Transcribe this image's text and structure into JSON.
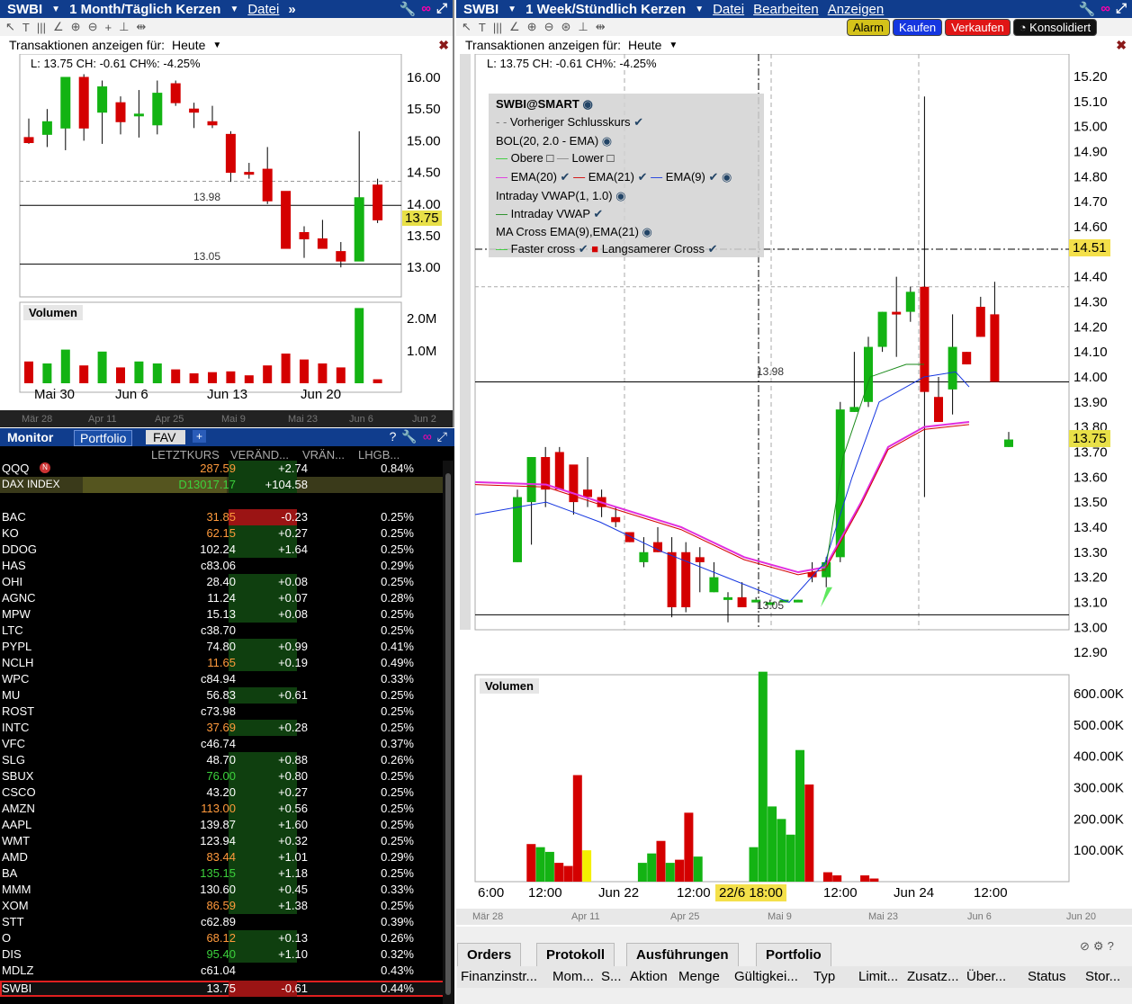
{
  "left_chart": {
    "symbol": "SWBI",
    "period": "1 Month/Täglich Kerzen",
    "menu_datei": "Datei",
    "tx_label": "Transaktionen anzeigen für:",
    "tx_value": "Heute",
    "info": "L: 13.75 CH: -0.61 CH%: -4.25%",
    "price_ticks": [
      "16.00",
      "15.50",
      "15.00",
      "14.50",
      "14.00",
      "13.50",
      "13.00"
    ],
    "line_labels": [
      "13.98",
      "13.05"
    ],
    "last_price": "13.75",
    "volume_title": "Volumen",
    "volume_ticks": [
      "2.0M",
      "1.0M"
    ],
    "date_ticks": [
      "Mai 30",
      "Jun 6",
      "Jun 13",
      "Jun 20"
    ],
    "scroll_ticks": [
      "Mär 28",
      "Apr 11",
      "Apr 25",
      "Mai 9",
      "Mai 23",
      "Jun 6",
      "Jun 2"
    ]
  },
  "chart_data": {
    "type": "candlestick",
    "series": [
      {
        "name": "SWBI",
        "candles": [
          {
            "o": 15.05,
            "h": 15.35,
            "l": 14.95,
            "c": 14.97
          },
          {
            "o": 15.1,
            "h": 15.5,
            "l": 14.9,
            "c": 15.3
          },
          {
            "o": 15.2,
            "h": 16.0,
            "l": 14.85,
            "c": 16.0
          },
          {
            "o": 16.0,
            "h": 16.05,
            "l": 15.0,
            "c": 15.2
          },
          {
            "o": 15.45,
            "h": 15.95,
            "l": 14.95,
            "c": 15.85
          },
          {
            "o": 15.6,
            "h": 15.7,
            "l": 15.1,
            "c": 15.3
          },
          {
            "o": 15.4,
            "h": 15.8,
            "l": 15.05,
            "c": 15.42
          },
          {
            "o": 15.25,
            "h": 15.95,
            "l": 15.1,
            "c": 15.75
          },
          {
            "o": 15.9,
            "h": 15.95,
            "l": 15.55,
            "c": 15.6
          },
          {
            "o": 15.5,
            "h": 15.6,
            "l": 15.2,
            "c": 15.45
          },
          {
            "o": 15.3,
            "h": 15.55,
            "l": 15.2,
            "c": 15.25
          },
          {
            "o": 15.1,
            "h": 15.15,
            "l": 14.35,
            "c": 14.5
          },
          {
            "o": 14.5,
            "h": 14.65,
            "l": 14.4,
            "c": 14.47
          },
          {
            "o": 14.55,
            "h": 14.9,
            "l": 14.0,
            "c": 14.05
          },
          {
            "o": 14.2,
            "h": 14.2,
            "l": 13.3,
            "c": 13.3
          },
          {
            "o": 13.55,
            "h": 13.65,
            "l": 13.15,
            "c": 13.45
          },
          {
            "o": 13.45,
            "h": 13.75,
            "l": 13.3,
            "c": 13.3
          },
          {
            "o": 13.25,
            "h": 13.4,
            "l": 13.0,
            "c": 13.1
          },
          {
            "o": 13.1,
            "h": 15.15,
            "l": 13.1,
            "c": 14.1
          },
          {
            "o": 14.3,
            "h": 14.4,
            "l": 13.7,
            "c": 13.75
          }
        ]
      }
    ],
    "volume": [
      0.55,
      0.5,
      0.85,
      0.45,
      0.8,
      0.4,
      0.55,
      0.5,
      0.35,
      0.25,
      0.28,
      0.3,
      0.2,
      0.45,
      0.75,
      0.6,
      0.5,
      0.4,
      1.9,
      0.1
    ]
  },
  "right_chart": {
    "symbol": "SWBI",
    "period": "1 Week/Stündlich Kerzen",
    "menus": [
      "Datei",
      "Bearbeiten",
      "Anzeigen"
    ],
    "buttons": {
      "alarm": "Alarm",
      "buy": "Kaufen",
      "sell": "Verkaufen",
      "consolidated": "Konsolidiert"
    },
    "tx_label": "Transaktionen anzeigen für:",
    "tx_value": "Heute",
    "info": "L: 13.75 CH: -0.61 CH%: -4.25%",
    "legend": {
      "title": "SWBI@SMART",
      "prev_close": "Vorheriger Schlusskurs",
      "bol": "BOL(20, 2.0 - EMA)",
      "upper": "Obere",
      "lower": "Lower",
      "ema20": "EMA(20)",
      "ema21": "EMA(21)",
      "ema9": "EMA(9)",
      "vwap": "Intraday VWAP(1, 1.0)",
      "vwap_line": "Intraday VWAP",
      "macross": "MA Cross EMA(9),EMA(21)",
      "faster": "Faster cross",
      "slower": "Langsamerer Cross"
    },
    "price_ticks": [
      "15.20",
      "15.10",
      "15.00",
      "14.90",
      "14.80",
      "14.70",
      "14.60",
      "14.50",
      "14.40",
      "14.30",
      "14.20",
      "14.10",
      "14.00",
      "13.90",
      "13.80",
      "13.70",
      "13.60",
      "13.50",
      "13.40",
      "13.30",
      "13.20",
      "13.10",
      "13.00",
      "12.90"
    ],
    "crosshair_price": "14.51",
    "last_price": "13.75",
    "line_labels": [
      "13.98",
      "13.05"
    ],
    "volume_title": "Volumen",
    "volume_ticks": [
      "600.00K",
      "500.00K",
      "400.00K",
      "300.00K",
      "200.00K",
      "100.00K"
    ],
    "time_ticks": [
      "6:00",
      "12:00",
      "Jun 22",
      "12:00",
      "12:00",
      "Jun 24",
      "12:00"
    ],
    "crosshair_time": "22/6 18:00",
    "scroll_ticks": [
      "Mär 28",
      "Apr 11",
      "Apr 25",
      "Mai 9",
      "Mai 23",
      "Jun 6",
      "Jun 20"
    ]
  },
  "monitor": {
    "tabs": [
      "Monitor",
      "Portfolio",
      "FAV",
      "+"
    ],
    "columns": [
      "LETZTKURS",
      "VERÄND...",
      "VRÄN...",
      "LHGB..."
    ],
    "rows": [
      {
        "sym": "QQQ",
        "last": "287.59",
        "chg": "+2.74",
        "pct": "0.84%",
        "lc": "#ff9a3c",
        "cc": "#fff"
      },
      {
        "sym": "DAX INDEX",
        "last": "D13017.17",
        "chg": "+104.58",
        "pct": "",
        "lc": "#3cd23c",
        "cc": "#fff"
      },
      {
        "sym": "",
        "last": "",
        "chg": "",
        "pct": "",
        "lc": "#fff",
        "cc": "#fff"
      },
      {
        "sym": "BAC",
        "last": "31.85",
        "chg": "-0.23",
        "pct": "0.25%",
        "lc": "#ff9a3c",
        "cc": "#fff"
      },
      {
        "sym": "KO",
        "last": "62.15",
        "chg": "+0.27",
        "pct": "0.25%",
        "lc": "#ff9a3c",
        "cc": "#fff"
      },
      {
        "sym": "DDOG",
        "last": "102.24",
        "chg": "+1.64",
        "pct": "0.25%",
        "lc": "#fff",
        "cc": "#fff"
      },
      {
        "sym": "HAS",
        "last": "c83.06",
        "chg": "",
        "pct": "0.29%",
        "lc": "#fff",
        "cc": "#fff"
      },
      {
        "sym": "OHI",
        "last": "28.40",
        "chg": "+0.08",
        "pct": "0.25%",
        "lc": "#fff",
        "cc": "#fff"
      },
      {
        "sym": "AGNC",
        "last": "11.24",
        "chg": "+0.07",
        "pct": "0.28%",
        "lc": "#fff",
        "cc": "#fff"
      },
      {
        "sym": "MPW",
        "last": "15.13",
        "chg": "+0.08",
        "pct": "0.25%",
        "lc": "#fff",
        "cc": "#fff"
      },
      {
        "sym": "LTC",
        "last": "c38.70",
        "chg": "",
        "pct": "0.25%",
        "lc": "#fff",
        "cc": "#fff"
      },
      {
        "sym": "PYPL",
        "last": "74.80",
        "chg": "+0.99",
        "pct": "0.41%",
        "lc": "#fff",
        "cc": "#fff"
      },
      {
        "sym": "NCLH",
        "last": "11.65",
        "chg": "+0.19",
        "pct": "0.49%",
        "lc": "#ff9a3c",
        "cc": "#fff"
      },
      {
        "sym": "WPC",
        "last": "c84.94",
        "chg": "",
        "pct": "0.33%",
        "lc": "#fff",
        "cc": "#fff"
      },
      {
        "sym": "MU",
        "last": "56.83",
        "chg": "+0.61",
        "pct": "0.25%",
        "lc": "#fff",
        "cc": "#fff"
      },
      {
        "sym": "ROST",
        "last": "c73.98",
        "chg": "",
        "pct": "0.25%",
        "lc": "#fff",
        "cc": "#fff"
      },
      {
        "sym": "INTC",
        "last": "37.69",
        "chg": "+0.28",
        "pct": "0.25%",
        "lc": "#ff9a3c",
        "cc": "#fff"
      },
      {
        "sym": "VFC",
        "last": "c46.74",
        "chg": "",
        "pct": "0.37%",
        "lc": "#fff",
        "cc": "#fff"
      },
      {
        "sym": "SLG",
        "last": "48.70",
        "chg": "+0.88",
        "pct": "0.26%",
        "lc": "#fff",
        "cc": "#fff"
      },
      {
        "sym": "SBUX",
        "last": "76.00",
        "chg": "+0.80",
        "pct": "0.25%",
        "lc": "#3cd23c",
        "cc": "#fff"
      },
      {
        "sym": "CSCO",
        "last": "43.20",
        "chg": "+0.27",
        "pct": "0.25%",
        "lc": "#fff",
        "cc": "#fff"
      },
      {
        "sym": "AMZN",
        "last": "113.00",
        "chg": "+0.56",
        "pct": "0.25%",
        "lc": "#ff9a3c",
        "cc": "#fff"
      },
      {
        "sym": "AAPL",
        "last": "139.87",
        "chg": "+1.60",
        "pct": "0.25%",
        "lc": "#fff",
        "cc": "#fff"
      },
      {
        "sym": "WMT",
        "last": "123.94",
        "chg": "+0.32",
        "pct": "0.25%",
        "lc": "#fff",
        "cc": "#fff"
      },
      {
        "sym": "AMD",
        "last": "83.44",
        "chg": "+1.01",
        "pct": "0.29%",
        "lc": "#ff9a3c",
        "cc": "#fff"
      },
      {
        "sym": "BA",
        "last": "135.15",
        "chg": "+1.18",
        "pct": "0.25%",
        "lc": "#3cd23c",
        "cc": "#fff"
      },
      {
        "sym": "MMM",
        "last": "130.60",
        "chg": "+0.45",
        "pct": "0.33%",
        "lc": "#fff",
        "cc": "#fff"
      },
      {
        "sym": "XOM",
        "last": "86.59",
        "chg": "+1.38",
        "pct": "0.25%",
        "lc": "#ff9a3c",
        "cc": "#fff"
      },
      {
        "sym": "STT",
        "last": "c62.89",
        "chg": "",
        "pct": "0.39%",
        "lc": "#fff",
        "cc": "#fff"
      },
      {
        "sym": "O",
        "last": "68.12",
        "chg": "+0.13",
        "pct": "0.26%",
        "lc": "#ff9a3c",
        "cc": "#fff"
      },
      {
        "sym": "DIS",
        "last": "95.40",
        "chg": "+1.10",
        "pct": "0.32%",
        "lc": "#3cd23c",
        "cc": "#fff"
      },
      {
        "sym": "MDLZ",
        "last": "c61.04",
        "chg": "",
        "pct": "0.43%",
        "lc": "#fff",
        "cc": "#fff"
      },
      {
        "sym": "SWBI",
        "last": "13.75",
        "chg": "-0.61",
        "pct": "0.44%",
        "lc": "#fff",
        "cc": "#fff"
      }
    ]
  },
  "orders_panel": {
    "tabs": [
      "Orders",
      "Protokoll",
      "Ausführungen",
      "Portfolio"
    ],
    "columns": [
      "Finanzinstr...",
      "Mom...",
      "S...",
      "Aktion",
      "Menge",
      "Gültigkei...",
      "Typ",
      "Limit...",
      "Zusatz...",
      "Über...",
      "Status",
      "Stor..."
    ]
  },
  "colors": {
    "up": "#13b313",
    "down": "#d40000",
    "title_bg": "#103d8d",
    "crosshair_label": "#f4e04a"
  }
}
